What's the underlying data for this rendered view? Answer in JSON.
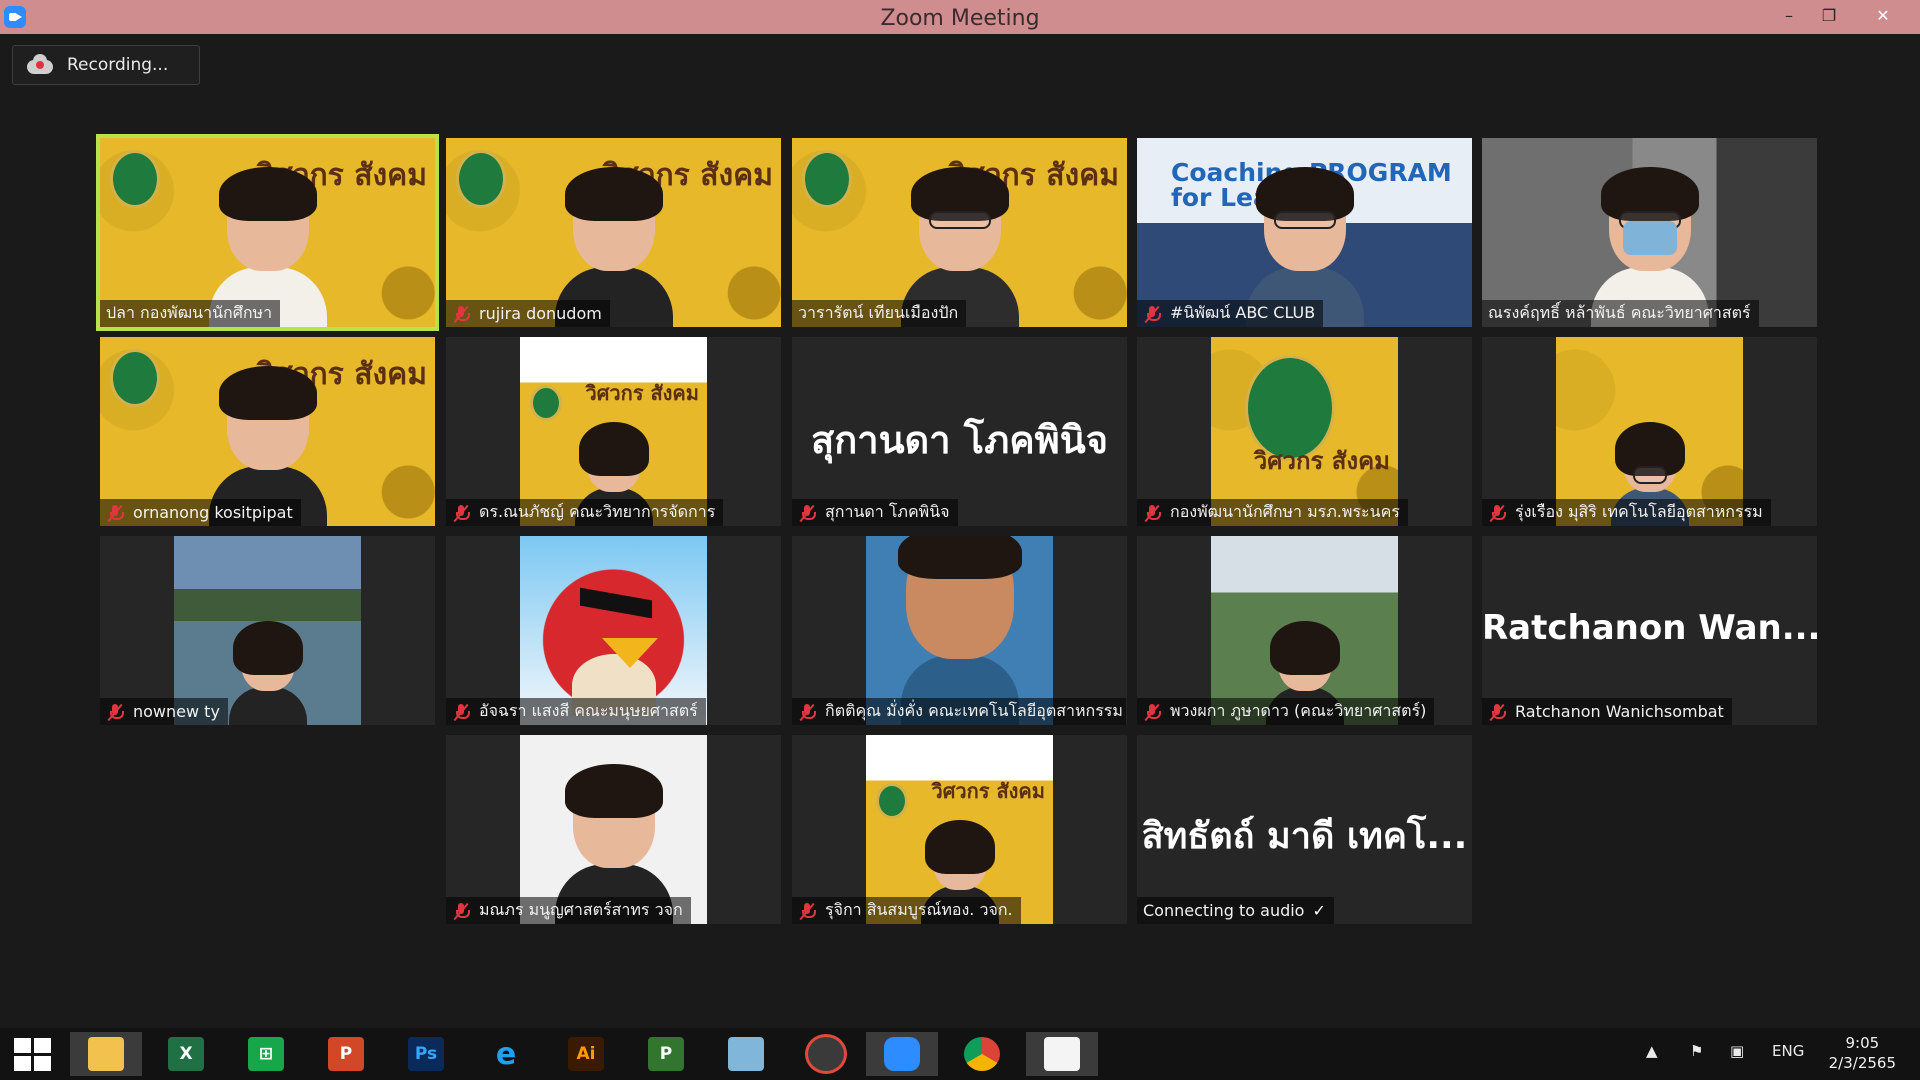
{
  "window": {
    "title": "Zoom Meeting",
    "minimize": "–",
    "restore": "❐",
    "close": "✕"
  },
  "recording": {
    "label": "Recording..."
  },
  "tiles": [
    {
      "name": "ปลา กองพัฒนานักศึกษา",
      "banner": "วิศวกร สังคม"
    },
    {
      "name": "rujira donudom",
      "banner": "วิศวกร สังคม"
    },
    {
      "name": "วารารัตน์ เทียนเมืองปัก",
      "banner": "วิศวกร สังคม"
    },
    {
      "name": "#นิพัฒน์ ABC CLUB",
      "overlay": "Coaching PROGRAM\nfor Learner"
    },
    {
      "name": "ณรงค์ฤทธิ์ หล้าพันธ์ คณะวิทยาศาสตร์"
    },
    {
      "name": "ornanong kositpipat",
      "banner": "วิศวกร สังคม"
    },
    {
      "name": "ดร.ณนภัชญ์ คณะวิทยาการจัดการ",
      "banner": "วิศวกร สังคม"
    },
    {
      "name": "สุกานดา โภคพินิจ",
      "display": "สุกานดา โภคพินิจ"
    },
    {
      "name": "กองพัฒนานักศึกษา มรภ.พระนคร",
      "banner": "วิศวกร สังคม"
    },
    {
      "name": "รุ่งเรือง มุสิริ เทคโนโลยีอุตสาหกรรม"
    },
    {
      "name": "nownew ty"
    },
    {
      "name": "อัจฉรา แสงสี คณะมนุษยศาสตร์"
    },
    {
      "name": "กิตติคุณ มั่งคั่ง คณะเทคโนโลยีอุตสาหกรรม"
    },
    {
      "name": "พวงผกา ภูษาดาว (คณะวิทยาศาสตร์)"
    },
    {
      "name": "Ratchanon Wanichsombat",
      "display": "Ratchanon  Wan..."
    },
    {
      "name": "มณภร มนูญศาสตร์สาทร วจก"
    },
    {
      "name": "รุจิกา สินสมบูรณ์ทอง. วจก.",
      "banner": "วิศวกร สังคม"
    },
    {
      "name": "Connecting to audio",
      "display": "สิทธัตถ์ มาดี เทคโ..."
    }
  ],
  "taskbar": {
    "apps": [
      "start",
      "file-explorer",
      "excel",
      "store",
      "powerpoint",
      "photoshop",
      "internet-explorer",
      "illustrator",
      "project",
      "paint",
      "photoscape",
      "zoom",
      "chrome",
      "snipping"
    ],
    "labels": {
      "excel": "X",
      "store": "⊞",
      "powerpoint": "P",
      "photoshop": "Ps",
      "illustrator": "Ai",
      "project": "P",
      "internet-explorer": "e"
    },
    "language": "ENG",
    "time": "9:05",
    "date": "2/3/2565"
  },
  "colors": {
    "titlebar": "#cf8d90",
    "active_speaker": "#b6e34b",
    "muted": "#e0363f",
    "background": "#1a1a1a"
  }
}
